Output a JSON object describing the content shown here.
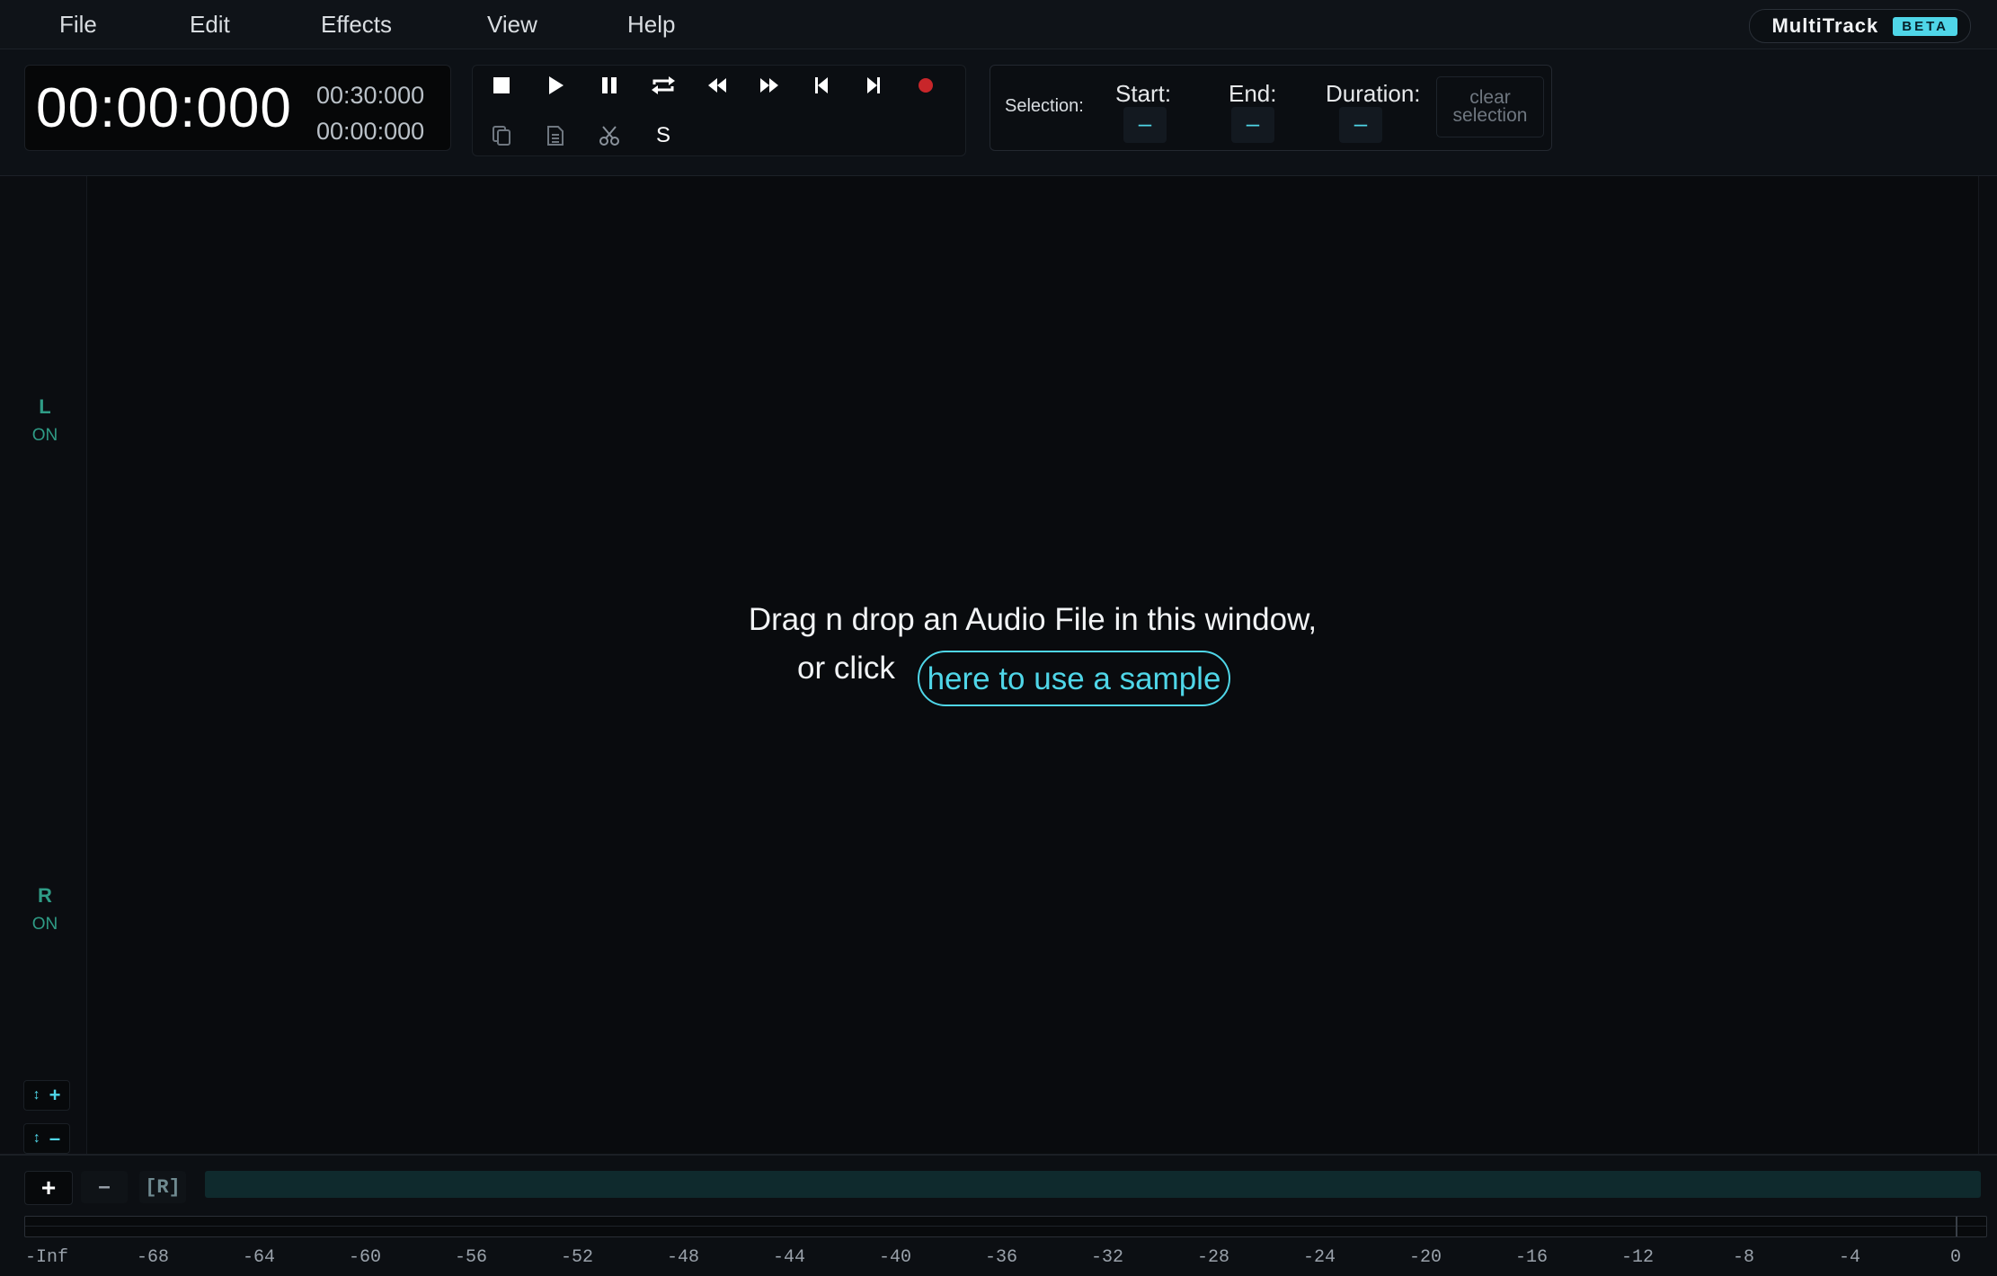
{
  "menu": {
    "items": [
      "File",
      "Edit",
      "Effects",
      "View",
      "Help"
    ],
    "brand": "MultiTrack",
    "badge": "BETA"
  },
  "time": {
    "current": "00:00:000",
    "total": "00:30:000",
    "selection": "00:00:000"
  },
  "transport": {
    "buttons": [
      "stop",
      "play",
      "pause",
      "loop",
      "rewind",
      "fast-forward",
      "skip-to-start",
      "skip-to-end",
      "record"
    ],
    "edit_buttons": [
      "copy",
      "paste",
      "cut",
      "silence"
    ],
    "silence_label": "S"
  },
  "selection": {
    "label": "Selection:",
    "start_label": "Start:",
    "end_label": "End:",
    "duration_label": "Duration:",
    "start_value": "–",
    "end_value": "–",
    "duration_value": "–",
    "clear_label_1": "clear",
    "clear_label_2": "selection"
  },
  "channels": {
    "left": {
      "letter": "L",
      "state": "ON"
    },
    "right": {
      "letter": "R",
      "state": "ON"
    }
  },
  "drop": {
    "line1": "Drag n drop an Audio File in this window,",
    "line2": "or click",
    "sample_button": "here to use a sample"
  },
  "bottom": {
    "add_label": "+",
    "remove_label": "–",
    "reset_label": "[R]",
    "db_scale": [
      "-Inf",
      "-68",
      "-64",
      "-60",
      "-56",
      "-52",
      "-48",
      "-44",
      "-40",
      "-36",
      "-32",
      "-28",
      "-24",
      "-20",
      "-16",
      "-12",
      "-8",
      "-4",
      "0"
    ]
  },
  "colors": {
    "accent": "#4fd6e8",
    "channel_on": "#2f9c86",
    "record": "#c8262a",
    "background": "#090b0e"
  }
}
